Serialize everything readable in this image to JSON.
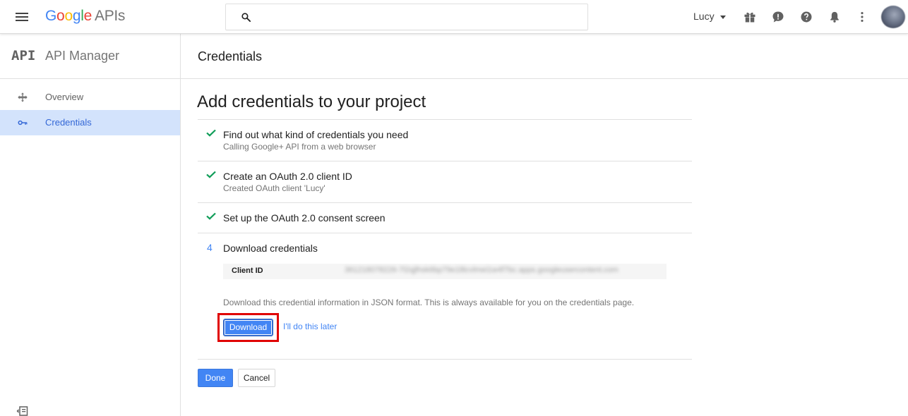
{
  "topbar": {
    "logo": {
      "G": "G",
      "o1": "o",
      "o2": "o",
      "g": "g",
      "l": "l",
      "e": "e",
      "apis": "APIs"
    },
    "search": {
      "value": "",
      "placeholder": ""
    },
    "account": "Lucy",
    "icons": [
      "menu-icon",
      "search-icon",
      "gift-icon",
      "feedback-icon",
      "help-icon",
      "notifications-icon",
      "more-vert-icon",
      "avatar"
    ]
  },
  "sidebar": {
    "glyph": "API",
    "title": "API Manager",
    "items": [
      {
        "label": "Overview",
        "icon": "overview-icon",
        "active": false
      },
      {
        "label": "Credentials",
        "icon": "key-icon",
        "active": true
      }
    ]
  },
  "main": {
    "header_title": "Credentials",
    "heading": "Add credentials to your project",
    "steps": [
      {
        "status": "done",
        "title": "Find out what kind of credentials you need",
        "subtitle": "Calling Google+ API from a web browser"
      },
      {
        "status": "done",
        "title": "Create an OAuth 2.0 client ID",
        "subtitle": "Created OAuth client 'Lucy'"
      },
      {
        "status": "done",
        "title": "Set up the OAuth 2.0 consent screen",
        "subtitle": ""
      },
      {
        "status": "current",
        "number": "4",
        "title": "Download credentials",
        "client_id_label": "Client ID",
        "client_id_value": "361218078226-7l2qjlhsk6bp79e1l8cvlmei1w4f7bc.apps.googleusercontent.com",
        "description": "Download this credential information in JSON format. This is always available for you on the credentials page.",
        "download_label": "Download",
        "later_label": "I'll do this later"
      }
    ],
    "done_label": "Done",
    "cancel_label": "Cancel"
  },
  "colors": {
    "accent": "#4285f4",
    "check": "#0f9d58",
    "active_nav_bg": "#d3e3fc",
    "highlight": "#e00000"
  }
}
